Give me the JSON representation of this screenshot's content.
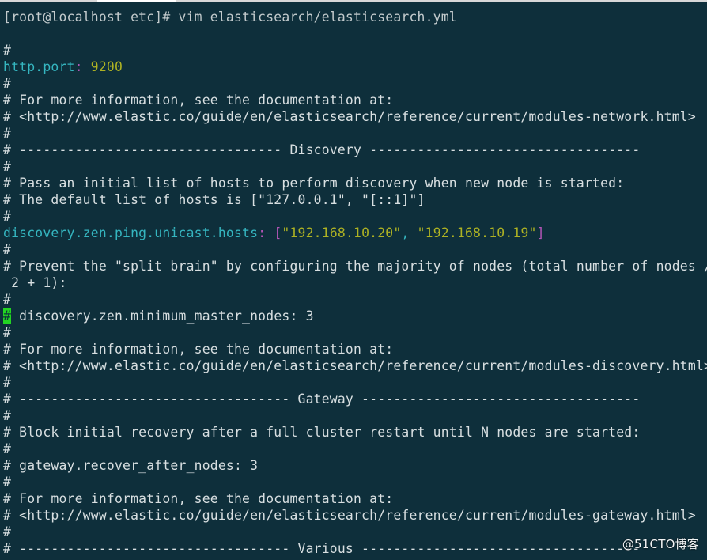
{
  "terminal": {
    "prompt": "[root@localhost etc]# vim elasticsearch/elasticsearch.yml",
    "lines": [
      {
        "type": "blank"
      },
      {
        "type": "comment",
        "text": "#"
      },
      {
        "type": "setting",
        "key": "http.port",
        "sep": ":",
        "value": " 9200"
      },
      {
        "type": "comment",
        "text": "#"
      },
      {
        "type": "comment",
        "text": "# For more information, see the documentation at:"
      },
      {
        "type": "comment",
        "text": "# <http://www.elastic.co/guide/en/elasticsearch/reference/current/modules-network.html>"
      },
      {
        "type": "comment",
        "text": "#"
      },
      {
        "type": "comment",
        "text": "# --------------------------------- Discovery ----------------------------------"
      },
      {
        "type": "comment",
        "text": "#"
      },
      {
        "type": "comment",
        "text": "# Pass an initial list of hosts to perform discovery when new node is started:"
      },
      {
        "type": "comment",
        "text": "# The default list of hosts is [\"127.0.0.1\", \"[::1]\"]"
      },
      {
        "type": "comment",
        "text": "#"
      },
      {
        "type": "array-setting",
        "key": "discovery.zen.ping.unicast.hosts",
        "sep": ":",
        "open": " [",
        "items": [
          "\"192.168.10.20\"",
          "\"192.168.10.19\""
        ],
        "close": "]"
      },
      {
        "type": "comment",
        "text": "#"
      },
      {
        "type": "comment",
        "text": "# Prevent the \"split brain\" by configuring the majority of nodes (total number of nodes /"
      },
      {
        "type": "comment",
        "text": " 2 + 1):"
      },
      {
        "type": "comment",
        "text": "#"
      },
      {
        "type": "cursor-comment",
        "cursor": "#",
        "text": " discovery.zen.minimum_master_nodes: 3"
      },
      {
        "type": "comment",
        "text": "#"
      },
      {
        "type": "comment",
        "text": "# For more information, see the documentation at:"
      },
      {
        "type": "comment",
        "text": "# <http://www.elastic.co/guide/en/elasticsearch/reference/current/modules-discovery.html>"
      },
      {
        "type": "comment",
        "text": "#"
      },
      {
        "type": "comment",
        "text": "# ---------------------------------- Gateway -----------------------------------"
      },
      {
        "type": "comment",
        "text": "#"
      },
      {
        "type": "comment",
        "text": "# Block initial recovery after a full cluster restart until N nodes are started:"
      },
      {
        "type": "comment",
        "text": "#"
      },
      {
        "type": "comment",
        "text": "# gateway.recover_after_nodes: 3"
      },
      {
        "type": "comment",
        "text": "#"
      },
      {
        "type": "comment",
        "text": "# For more information, see the documentation at:"
      },
      {
        "type": "comment",
        "text": "# <http://www.elastic.co/guide/en/elasticsearch/reference/current/modules-gateway.html>"
      },
      {
        "type": "comment",
        "text": "#"
      },
      {
        "type": "comment",
        "text": "# ---------------------------------- Various -----------------------------------"
      }
    ]
  },
  "watermark": "@51CTO博客"
}
